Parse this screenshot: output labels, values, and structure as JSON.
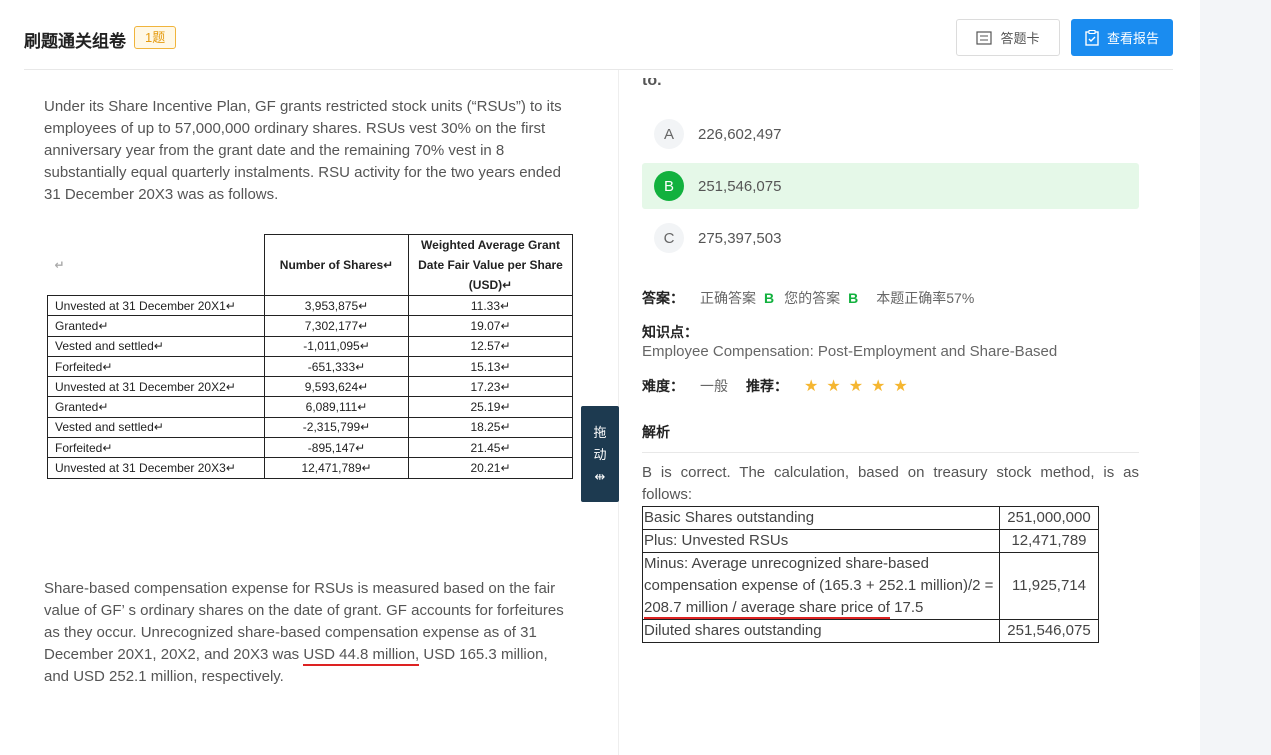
{
  "header": {
    "title": "刷题通关组卷",
    "badge": "1题",
    "card_button": "答题卡",
    "report_button": "查看报告"
  },
  "question": {
    "intro": "Under its Share Incentive Plan, GF grants restricted stock units (“RSUs”) to its employees of up to 57,000,000 ordinary shares. RSUs vest 30% on the first anniversary year from the grant date and the remaining 70% vest in 8 substantially equal quarterly instalments. RSU activity for the two years ended 31 December 20X3 was as follows.",
    "table": {
      "corner": "↵",
      "headers": [
        "Number of Shares↵",
        "Weighted Average Grant Date Fair Value per Share (USD)↵"
      ],
      "rows": [
        [
          "Unvested at 31 December 20X1↵",
          "3,953,875↵",
          "11.33↵"
        ],
        [
          "Granted↵",
          "7,302,177↵",
          "19.07↵"
        ],
        [
          "Vested and settled↵",
          "-1,011,095↵",
          "12.57↵"
        ],
        [
          "Forfeited↵",
          "-651,333↵",
          "15.13↵"
        ],
        [
          "Unvested at 31 December 20X2↵",
          "9,593,624↵",
          "17.23↵"
        ],
        [
          "Granted↵",
          "6,089,111↵",
          "25.19↵"
        ],
        [
          "Vested and settled↵",
          "-2,315,799↵",
          "18.25↵"
        ],
        [
          "Forfeited↵",
          "-895,147↵",
          "21.45↵"
        ],
        [
          "Unvested at 31 December 20X3↵",
          "12,471,789↵",
          "20.21↵"
        ]
      ]
    },
    "para2_a": "Share-based compensation expense for RSUs is measured based on the fair value of GF’ s ordinary shares on the date of grant. GF accounts for forfeitures as they occur. Unrecognized share-based compensation expense as of 31 December 20X1, 20X2, and 20X3 was ",
    "para2_ul": "USD 44.8 million,",
    "para2_b": " USD 165.3 million, and USD 252.1 million, respectively.",
    "cut_text": "to."
  },
  "drag_handle": {
    "line1": "拖",
    "line2": "动",
    "icon": "⇹"
  },
  "options": [
    {
      "letter": "A",
      "text": "226,602,497"
    },
    {
      "letter": "B",
      "text": "251,546,075"
    },
    {
      "letter": "C",
      "text": "275,397,503"
    }
  ],
  "answer": {
    "label": "答案：",
    "correct_label": "正确答案",
    "correct": "B",
    "yours_label": "您的答案",
    "yours": "B",
    "rate": "本题正确率57%"
  },
  "knowledge": {
    "label": "知识点：",
    "value": "Employee Compensation: Post-Employment and Share-Based"
  },
  "difficulty": {
    "label": "难度：",
    "value": "一般",
    "rec_label": "推荐：",
    "stars": 5
  },
  "analysis": {
    "title": "解析",
    "text": "B is correct. The calculation, based on treasury stock method, is as follows:",
    "rows": [
      {
        "a": "Basic Shares outstanding",
        "b": "251,000,000"
      },
      {
        "a": "Plus: Unvested RSUs",
        "b": "12,471,789"
      },
      {
        "a1": "Minus: Average unrecognized share-based compensation expense of (165.3 + 252.1 million)/2 = ",
        "a_ul": "208.7 million / average share price of",
        "a2": " 17.5",
        "b": "11,925,714"
      },
      {
        "a": "Diluted shares outstanding",
        "b": "251,546,075"
      }
    ]
  },
  "colors": {
    "accent": "#1a8cf0",
    "correct": "#12b13e",
    "star": "#f5b631",
    "badge": "#e59b10"
  }
}
